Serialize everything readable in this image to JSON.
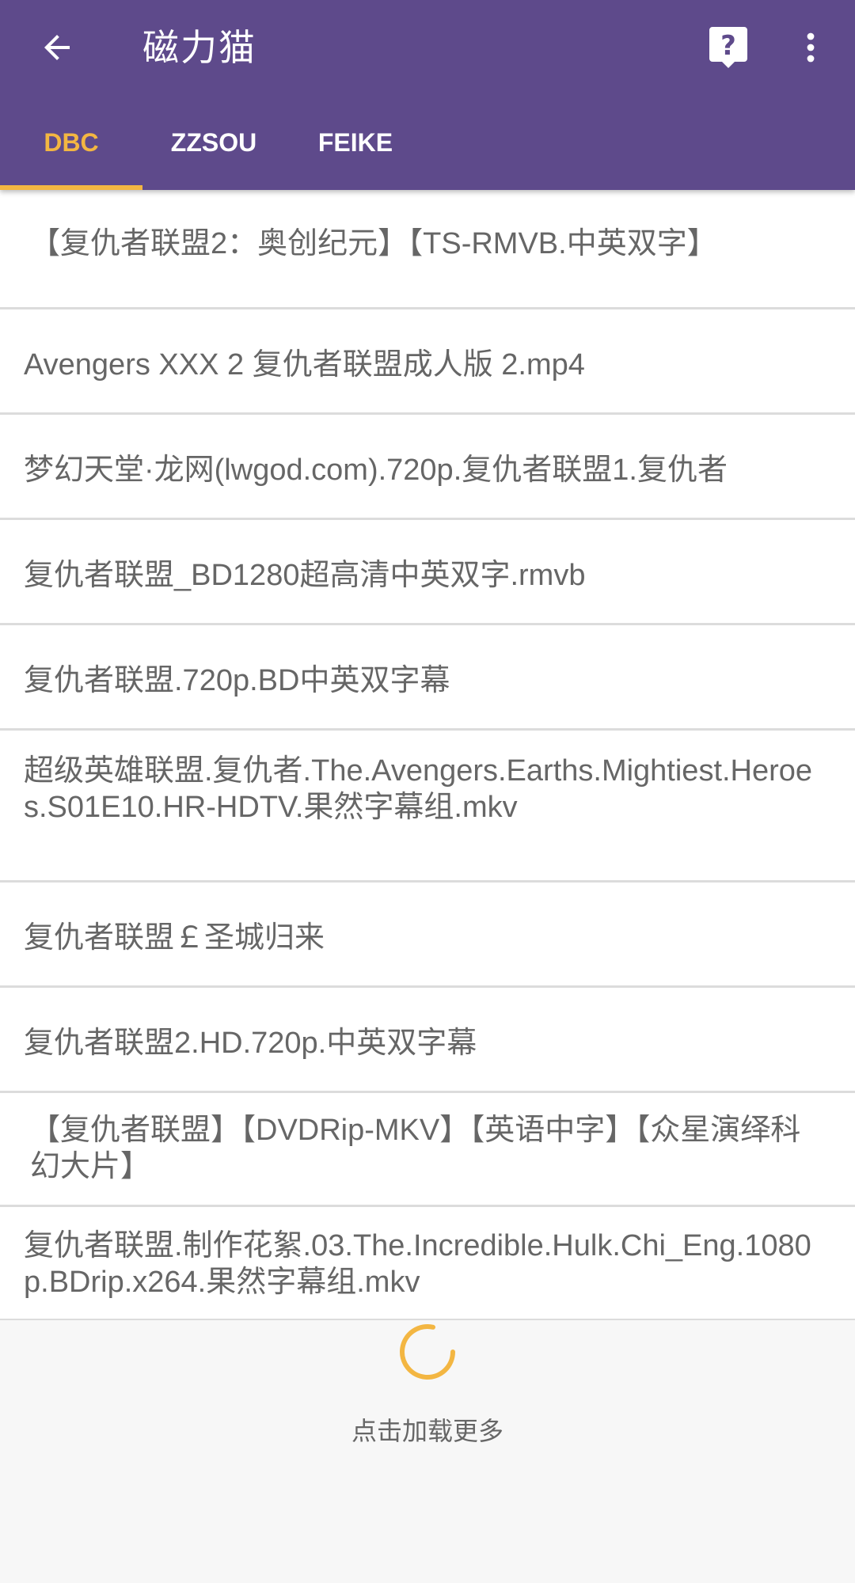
{
  "toolbar": {
    "title": "磁力猫",
    "back_icon": "arrow-back-icon",
    "help_icon": "help-icon",
    "more_icon": "more-vert-icon"
  },
  "colors": {
    "appbar": "#5e4a8b",
    "accent": "#f3b642",
    "text": "#666666",
    "divider": "#dcdcdc"
  },
  "tabs": [
    {
      "label": "DBC",
      "active": true
    },
    {
      "label": "ZZSOU",
      "active": false
    },
    {
      "label": "FEIKE",
      "active": false
    }
  ],
  "results": [
    "【复仇者联盟2：奥创纪元】【TS-RMVB.中英双字】",
    "Avengers XXX 2 复仇者联盟成人版 2.mp4",
    "梦幻天堂·龙网(lwgod.com).720p.复仇者联盟1.复仇者",
    "复仇者联盟_BD1280超高清中英双字.rmvb",
    "复仇者联盟.720p.BD中英双字幕",
    "超级英雄联盟.复仇者.The.Avengers.Earths.Mightiest.Heroes.S01E10.HR-HDTV.果然字幕组.mkv",
    "复仇者联盟￡圣城归来",
    "复仇者联盟2.HD.720p.中英双字幕",
    "【复仇者联盟】【DVDRip-MKV】【英语中字】【众星演绎科幻大片】",
    "复仇者联盟.制作花絮.03.The.Incredible.Hulk.Chi_Eng.1080p.BDrip.x264.果然字幕组.mkv"
  ],
  "footer": {
    "load_more_label": "点击加载更多",
    "spinner_icon": "loading-spinner-icon"
  }
}
